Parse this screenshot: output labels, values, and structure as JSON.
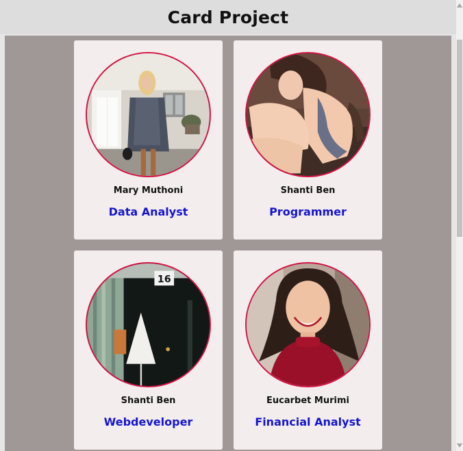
{
  "page": {
    "title": "Card Project"
  },
  "cards": [
    {
      "name": "Mary Muthoni",
      "role": "Data Analyst",
      "photo": "woman-street-photo"
    },
    {
      "name": "Shanti Ben",
      "role": "Programmer",
      "photo": "woman-sitting-photo"
    },
    {
      "name": "Shanti Ben",
      "role": "Webdeveloper",
      "photo": "door-sixteen-photo"
    },
    {
      "name": "Eucarbet Murimi",
      "role": "Financial Analyst",
      "photo": "smiling-woman-photo"
    }
  ],
  "photo_sign": "16",
  "colors": {
    "page_background": "#a09797",
    "header_background": "#dddddd",
    "card_background": "#f3eded",
    "avatar_border": "#d31343",
    "role_text": "#1515d2"
  }
}
